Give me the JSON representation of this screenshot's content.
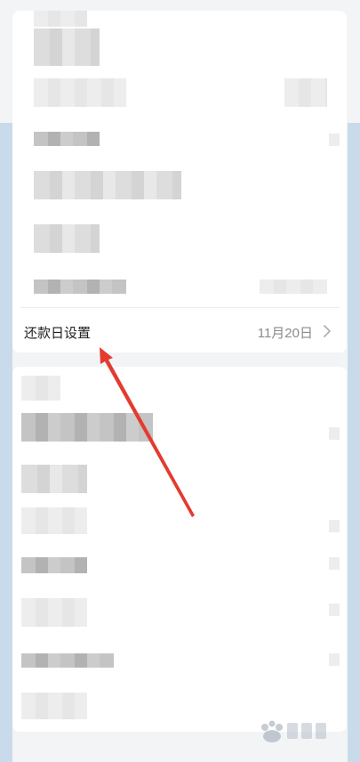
{
  "repayment_row": {
    "label": "还款日设置",
    "value": "11月20日"
  },
  "icons": {
    "chevron": "chevron-right-icon",
    "arrow": "annotation-arrow-icon",
    "watermark": "baidu-jingyan-watermark"
  },
  "colors": {
    "background": "#f3f4f6",
    "card": "#ffffff",
    "side_stripe": "#c9dbea",
    "label": "#1f1f1f",
    "value": "#8a8a8a",
    "arrow": "#e43b2f"
  }
}
